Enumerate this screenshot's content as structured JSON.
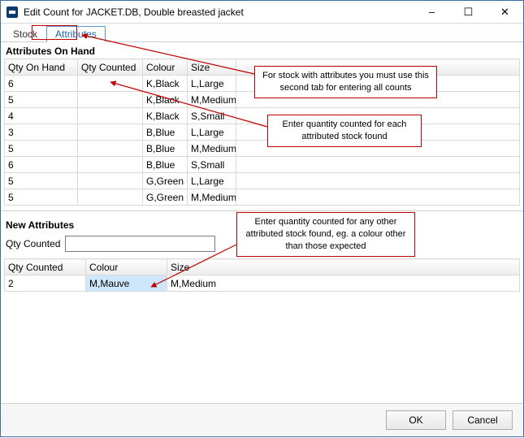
{
  "window": {
    "title": "Edit Count for JACKET.DB, Double breasted jacket",
    "buttons": {
      "minimize": "–",
      "maximize": "☐",
      "close": "✕"
    }
  },
  "tabs": {
    "stock": "Stock",
    "attributes": "Attributes"
  },
  "onHand": {
    "heading": "Attributes On Hand",
    "headers": {
      "qtyOnHand": "Qty On Hand",
      "qtyCounted": "Qty Counted",
      "colour": "Colour",
      "size": "Size"
    },
    "rows": [
      {
        "qtyOnHand": "6",
        "qtyCounted": "",
        "colour": "K,Black",
        "size": "L,Large"
      },
      {
        "qtyOnHand": "5",
        "qtyCounted": "",
        "colour": "K,Black",
        "size": "M,Medium"
      },
      {
        "qtyOnHand": "4",
        "qtyCounted": "",
        "colour": "K,Black",
        "size": "S,Small"
      },
      {
        "qtyOnHand": "3",
        "qtyCounted": "",
        "colour": "B,Blue",
        "size": "L,Large"
      },
      {
        "qtyOnHand": "5",
        "qtyCounted": "",
        "colour": "B,Blue",
        "size": "M,Medium"
      },
      {
        "qtyOnHand": "6",
        "qtyCounted": "",
        "colour": "B,Blue",
        "size": "S,Small"
      },
      {
        "qtyOnHand": "5",
        "qtyCounted": "",
        "colour": "G,Green",
        "size": "L,Large"
      },
      {
        "qtyOnHand": "5",
        "qtyCounted": "",
        "colour": "G,Green",
        "size": "M,Medium"
      }
    ]
  },
  "newAttrs": {
    "heading": "New Attributes",
    "qtyLabel": "Qty Counted",
    "qtyValue": "",
    "headers": {
      "qtyCounted": "Qty Counted",
      "colour": "Colour",
      "size": "Size"
    },
    "rows": [
      {
        "qtyCounted": "2",
        "colour": "M,Mauve",
        "size": "M,Medium"
      }
    ]
  },
  "footer": {
    "ok": "OK",
    "cancel": "Cancel"
  },
  "annotations": {
    "a": "For stock with attributes you must use this second tab for entering all counts",
    "b": "Enter quantity counted for each attributed stock found",
    "c": "Enter quantity counted for any other attributed stock found, eg. a colour other than those expected"
  }
}
